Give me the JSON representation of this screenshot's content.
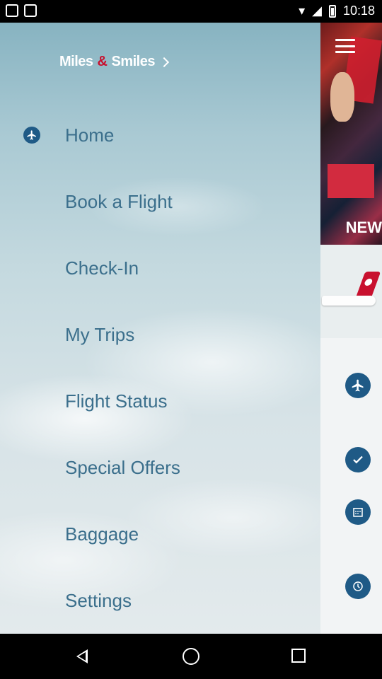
{
  "status_bar": {
    "time": "10:18"
  },
  "brand": {
    "name_part1": "Miles",
    "amp": "&",
    "name_part2": "Smiles"
  },
  "menu": [
    {
      "label": "Home",
      "icon": "plane-icon"
    },
    {
      "label": "Book a Flight"
    },
    {
      "label": "Check-In"
    },
    {
      "label": "My Trips"
    },
    {
      "label": "Flight Status"
    },
    {
      "label": "Special Offers"
    },
    {
      "label": "Baggage"
    },
    {
      "label": "Settings"
    }
  ],
  "side_panel": {
    "promo_text": "NEW"
  },
  "colors": {
    "accent": "#1f5a86",
    "brand_red": "#c8102e",
    "menu_text": "#3b6f8c"
  }
}
